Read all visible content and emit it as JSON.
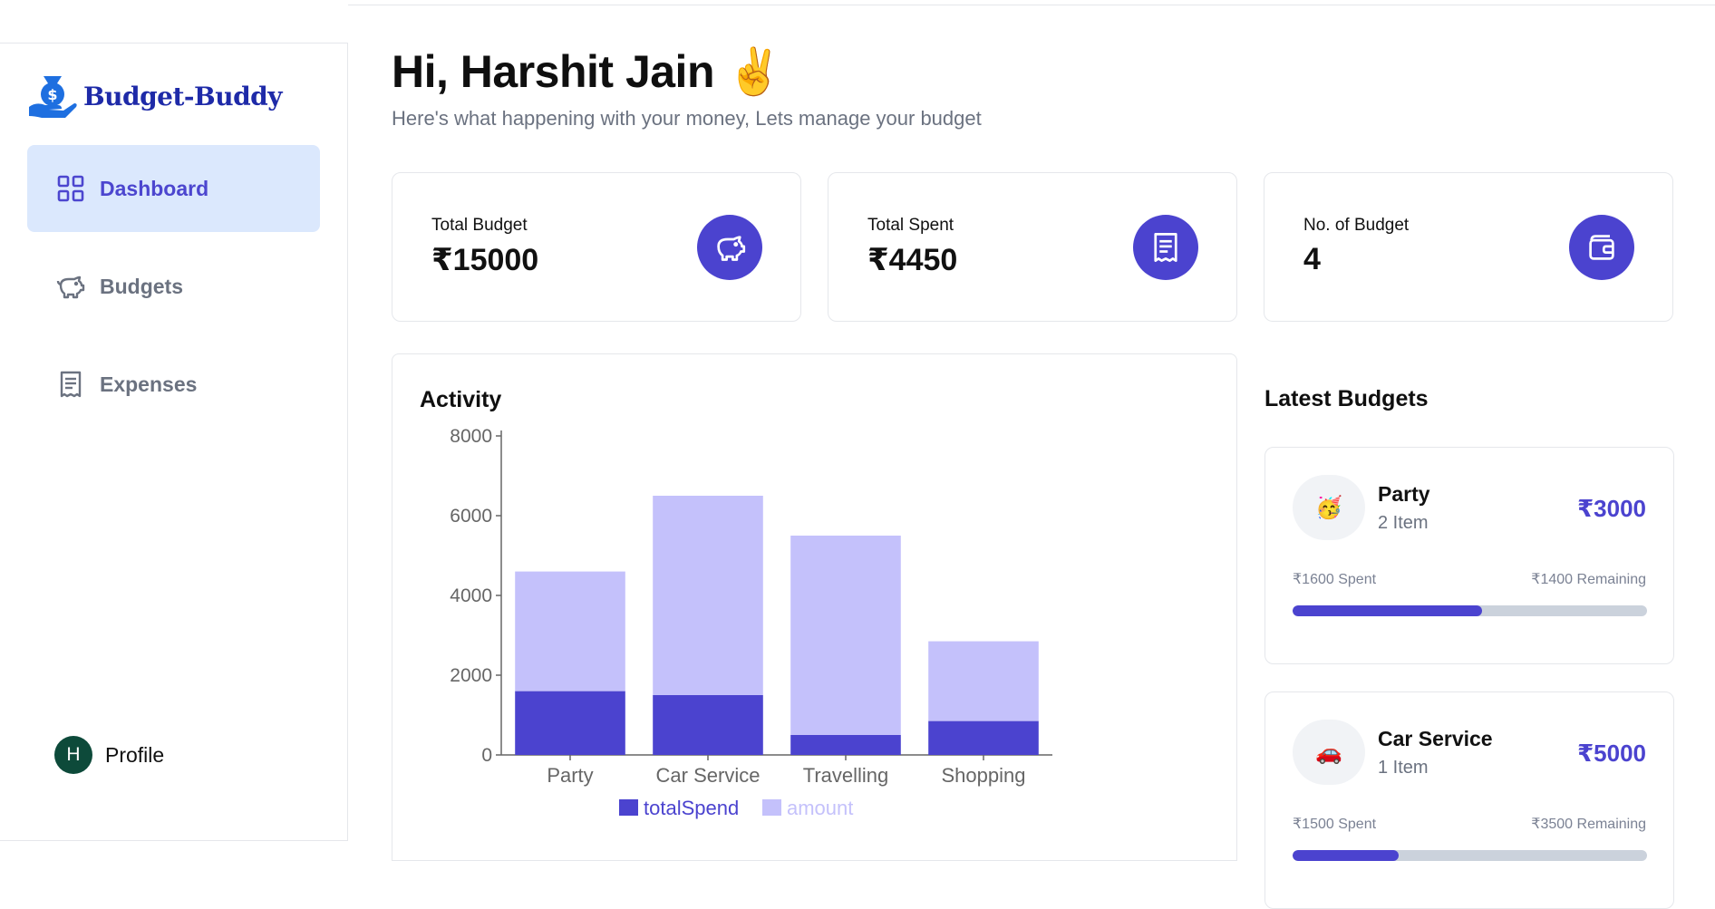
{
  "app": {
    "brand": "Budget-Buddy"
  },
  "sidebar": {
    "items": [
      {
        "label": "Dashboard",
        "icon": "grid-icon",
        "active": true
      },
      {
        "label": "Budgets",
        "icon": "piggy-bank-icon",
        "active": false
      },
      {
        "label": "Expenses",
        "icon": "receipt-icon",
        "active": false
      }
    ],
    "profile": {
      "initial": "H",
      "label": "Profile"
    }
  },
  "header": {
    "greeting": "Hi, Harshit Jain ✌️",
    "subtitle": "Here's what happening with your money, Lets manage your budget"
  },
  "stats": [
    {
      "label": "Total Budget",
      "value": "₹15000",
      "icon": "piggy-bank-icon"
    },
    {
      "label": "Total Spent",
      "value": "₹4450",
      "icon": "receipt-icon"
    },
    {
      "label": "No. of Budget",
      "value": "4",
      "icon": "wallet-icon"
    }
  ],
  "activity": {
    "title": "Activity"
  },
  "chart_data": {
    "type": "bar",
    "stacked": true,
    "categories": [
      "Party",
      "Car Service",
      "Travelling",
      "Shopping"
    ],
    "series": [
      {
        "name": "totalSpend",
        "values": [
          1600,
          1500,
          500,
          850
        ],
        "color": "#4b43cf"
      },
      {
        "name": "amount",
        "values": [
          3000,
          5000,
          5000,
          2000
        ],
        "color": "#c4c1fb"
      }
    ],
    "yticks": [
      0,
      2000,
      4000,
      6000,
      8000
    ],
    "ylim": [
      0,
      8000
    ],
    "legend": "bottom"
  },
  "latest": {
    "title": "Latest Budgets",
    "budgets": [
      {
        "emoji": "🥳",
        "name": "Party",
        "items": "2 Item",
        "amount": "₹3000",
        "spent": "₹1600 Spent",
        "remaining": "₹1400 Remaining",
        "progress": 0.5333
      },
      {
        "emoji": "🚗",
        "name": "Car Service",
        "items": "1 Item",
        "amount": "₹5000",
        "spent": "₹1500 Spent",
        "remaining": "₹3500 Remaining",
        "progress": 0.3
      }
    ]
  },
  "colors": {
    "accent": "#4b43cf",
    "accent_light": "#c4c1fb",
    "active_bg": "#dbe8fd",
    "muted": "#6b7280",
    "brand": "#1e2aa8"
  }
}
